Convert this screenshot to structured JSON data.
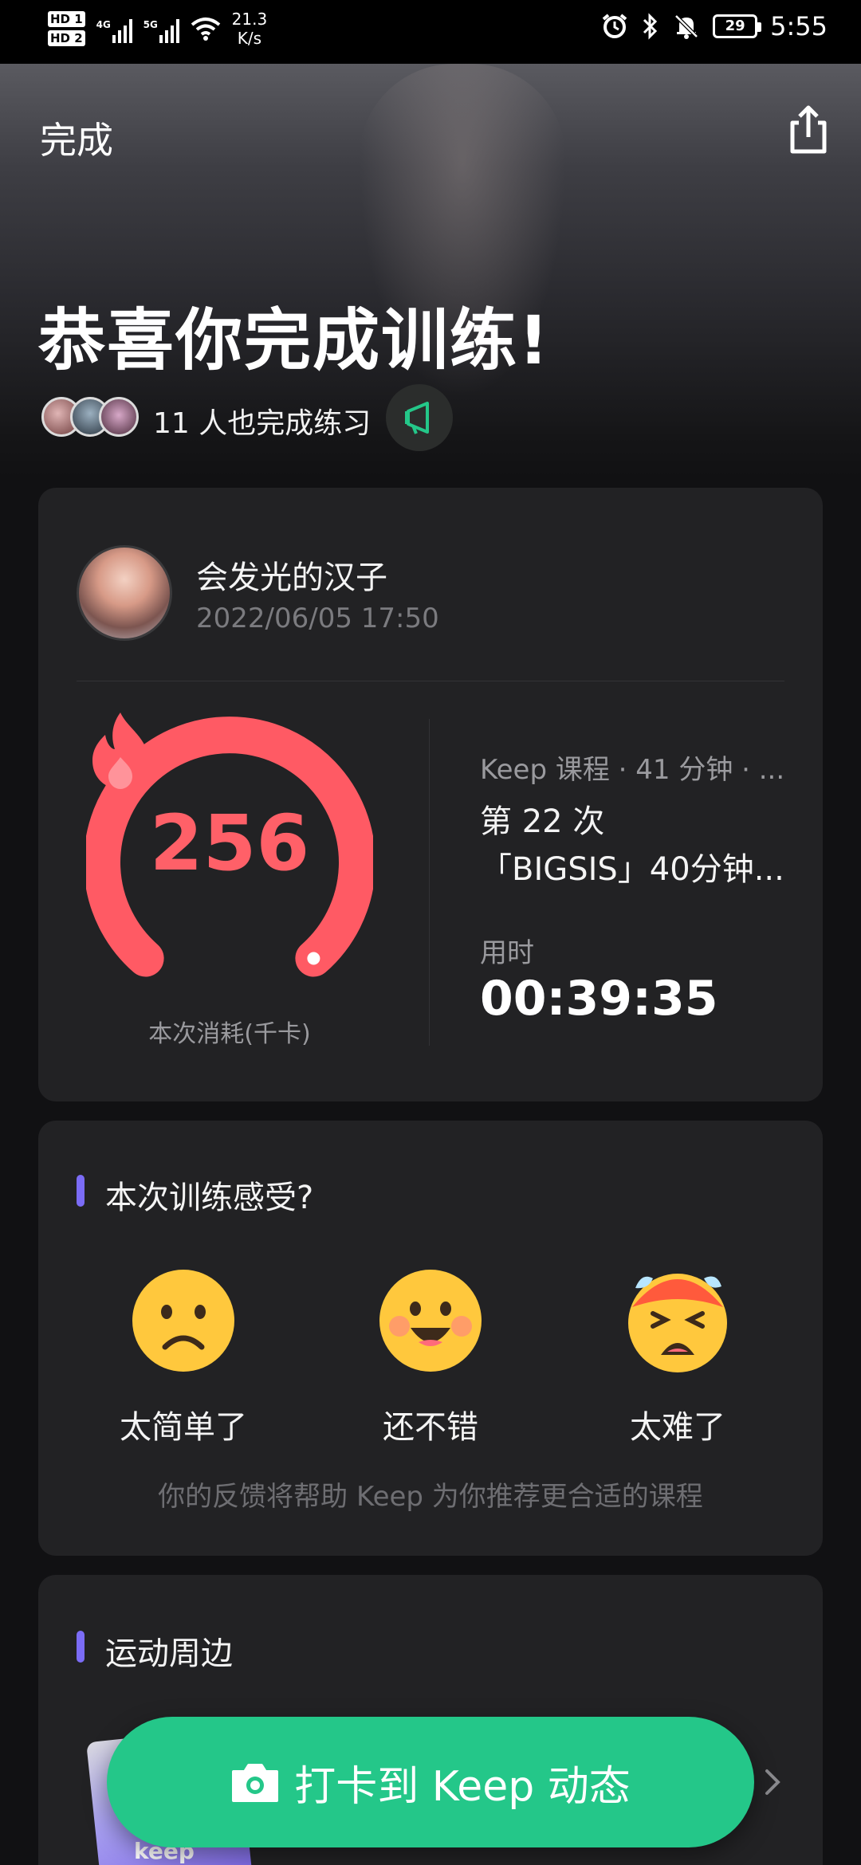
{
  "status_bar": {
    "sim1": "HD 1",
    "sim2": "HD 2",
    "net1": "4G",
    "net2": "5G",
    "speed_value": "21.3",
    "speed_unit": "K/s",
    "battery": "29",
    "time": "5:55"
  },
  "header": {
    "done_label": "完成",
    "title": "恭喜你完成训练!",
    "peers_text": "11 人也完成练习"
  },
  "summary": {
    "user_name": "会发光的汉子",
    "datetime": "2022/06/05 17:50",
    "calories": "256",
    "calories_progress": 1.0,
    "calories_label": "本次消耗(千卡)",
    "course_meta": "Keep 课程 · 41 分钟 · ...",
    "course_count": "第 22 次",
    "course_name": "「BIGSIS」40分钟...",
    "duration_label": "用时",
    "duration_value": "00:39:35"
  },
  "feedback": {
    "title": "本次训练感受?",
    "options": [
      "太简单了",
      "还不错",
      "太难了"
    ],
    "hint": "你的反馈将帮助 Keep 为你推荐更合适的课程"
  },
  "goods": {
    "title": "运动周边",
    "image_text": "keep"
  },
  "checkin": {
    "label": "打卡到 Keep 动态"
  },
  "colors": {
    "accent_green": "#24c789",
    "accent_red": "#ff6068",
    "section_bar": "#7b6cf6"
  }
}
